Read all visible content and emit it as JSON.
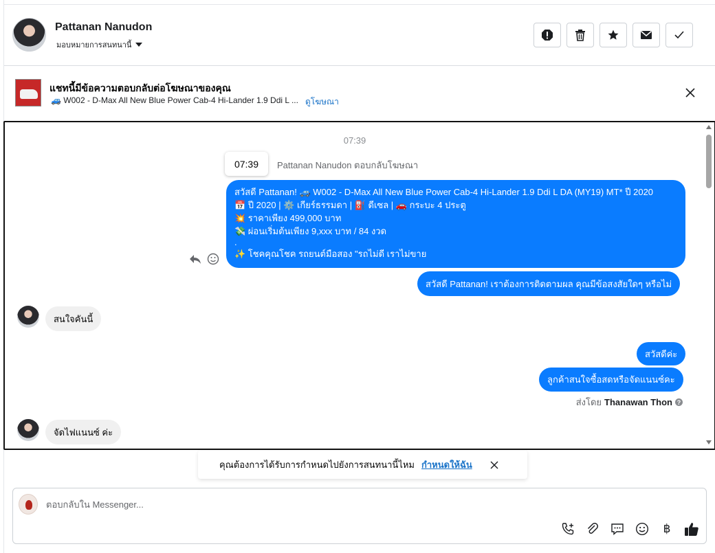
{
  "header": {
    "contact_name": "Pattanan Nanudon",
    "assign_label": "มอบหมายการสนทนานี้",
    "actions": [
      "report-icon",
      "trash-icon",
      "star-icon",
      "envelope-icon",
      "check-icon"
    ]
  },
  "ad_banner": {
    "title": "แชทนี้มีข้อความตอบกลับต่อโฆษณาของคุณ",
    "subtitle": "🚙 W002 - D-Max All New Blue Power Cab-4 Hi-Lander 1.9 Ddi L ...",
    "link": "ดูโฆษณา"
  },
  "thread": {
    "timestamp": "07:39",
    "tooltip_time": "07:39",
    "reply_note": "Pattanan Nanudon ตอบกลับโฆษณา",
    "ad_message_lines": [
      "สวัสดี Pattanan! 🚙 W002 - D-Max All New Blue Power Cab-4 Hi-Lander 1.9 Ddi L DA (MY19) MT* ปี 2020",
      "📅 ปี 2020 | ⚙️ เกียร์ธรรมดา | ⛽ ดีเซล | 🚗 กระบะ 4 ประตู",
      "💥 ราคาเพียง 499,000 บาท",
      "💸 ผ่อนเริ่มต้นเพียง 9,xxx บาท / 84 งวด",
      ".",
      "✨ โชคคุณโชค รถยนต์มือสอง \"รถไม่ดี เราไม่ขาย"
    ],
    "followup_message": "สวัสดี Pattanan! เราต้องการติดตามผล คุณมีข้อสงสัยใดๆ หรือไม่",
    "incoming_1": "สนใจคันนี้",
    "outgoing_1": "สวัสดีค่ะ",
    "outgoing_2": "ลูกค้าสนใจซื้อสดหรือจัดแนนซ์คะ",
    "sent_by_prefix": "ส่งโดย",
    "sent_by_name": "Thanawan Thon",
    "incoming_2": "จัดไฟแนนซ์ ค่ะ"
  },
  "assign_prompt": {
    "text": "คุณต้องการได้รับการกำหนดไปยังการสนทนานี้ไหม",
    "link": "กำหนดให้ฉัน"
  },
  "composer": {
    "placeholder": "ตอบกลับใน Messenger...",
    "tools": [
      "call-add-icon",
      "paperclip-icon",
      "saved-reply-icon",
      "emoji-icon",
      "baht-icon",
      "thumbs-up-icon"
    ]
  },
  "colors": {
    "outgoing_bubble": "#0a7cff",
    "incoming_bubble": "#f0f0f0",
    "link": "#1a73c8"
  }
}
